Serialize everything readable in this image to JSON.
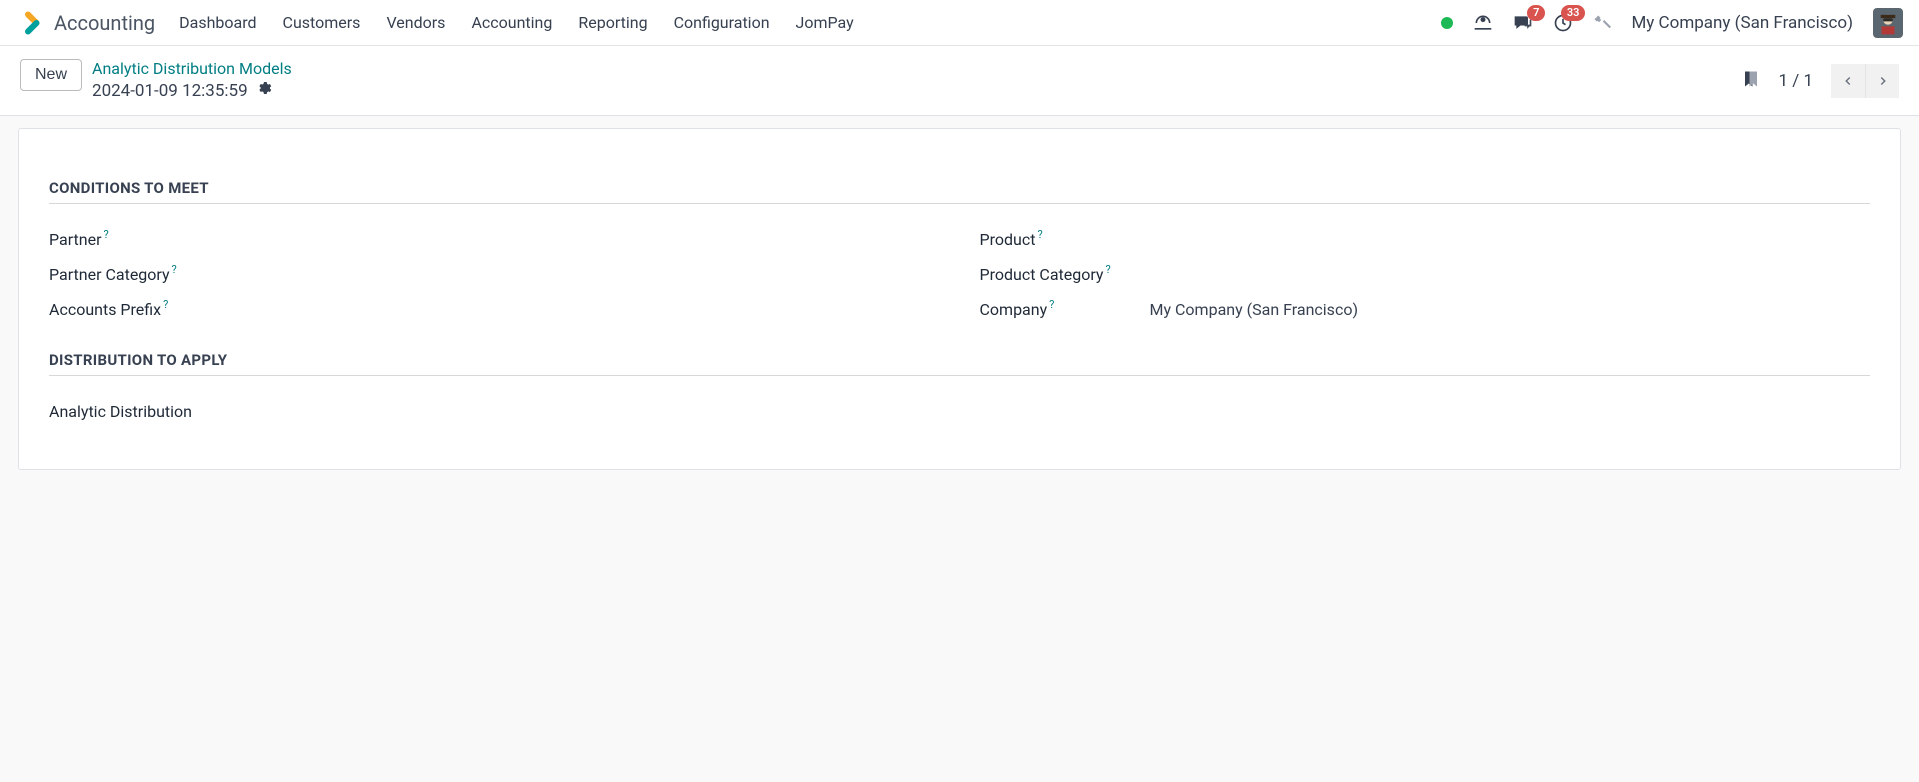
{
  "nav": {
    "app_name": "Accounting",
    "items": [
      "Dashboard",
      "Customers",
      "Vendors",
      "Accounting",
      "Reporting",
      "Configuration",
      "JomPay"
    ],
    "messages_badge": "7",
    "activities_badge": "33",
    "company": "My Company (San Francisco)"
  },
  "control_panel": {
    "new_label": "New",
    "breadcrumb": "Analytic Distribution Models",
    "record_title": "2024-01-09 12:35:59",
    "pager": "1 / 1"
  },
  "form": {
    "section_conditions": "Conditions to meet",
    "section_distribution": "Distribution to apply",
    "labels": {
      "partner": "Partner",
      "partner_category": "Partner Category",
      "accounts_prefix": "Accounts Prefix",
      "product": "Product",
      "product_category": "Product Category",
      "company": "Company",
      "analytic_distribution": "Analytic Distribution"
    },
    "values": {
      "partner": "",
      "partner_category": "",
      "accounts_prefix": "",
      "product": "",
      "product_category": "",
      "company": "My Company (San Francisco)",
      "analytic_distribution": ""
    },
    "help_marker": "?"
  }
}
